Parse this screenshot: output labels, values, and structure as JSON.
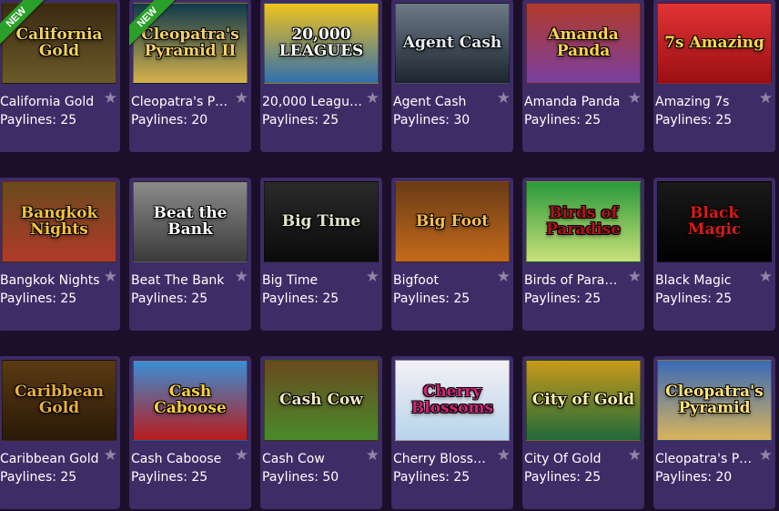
{
  "games": [
    {
      "title": "California Gold",
      "paylines": "Paylines: 25",
      "art": "California Gold",
      "badge": "NEW",
      "bg": "linear-gradient(#3b2a10,#6b5a2a)",
      "fg": "#f4d35a"
    },
    {
      "title": "Cleopatra's Pyr…",
      "paylines": "Paylines: 20",
      "art": "Cleopatra's Pyramid II",
      "badge": "NEW",
      "bg": "linear-gradient(#0f3a4c,#d6b24a)",
      "fg": "#f6d16a"
    },
    {
      "title": "20,000 Leagues",
      "paylines": "Paylines: 25",
      "art": "20,000 LEAGUES",
      "badge": "",
      "bg": "linear-gradient(#f0c21c,#2f6fb0)",
      "fg": "#ffffff"
    },
    {
      "title": "Agent Cash",
      "paylines": "Paylines: 30",
      "art": "Agent Cash",
      "badge": "",
      "bg": "linear-gradient(#6d7a86,#1c2530)",
      "fg": "#e8edf2"
    },
    {
      "title": "Amanda Panda",
      "paylines": "Paylines: 25",
      "art": "Amanda Panda",
      "badge": "",
      "bg": "linear-gradient(#b23a2a,#7a3fa0)",
      "fg": "#ffd54a"
    },
    {
      "title": "Amazing 7s",
      "paylines": "Paylines: 25",
      "art": "7s Amazing",
      "badge": "",
      "bg": "linear-gradient(#e23434,#9a0f12)",
      "fg": "#ffd84a"
    },
    {
      "title": "Bangkok Nights",
      "paylines": "Paylines: 25",
      "art": "Bangkok Nights",
      "badge": "",
      "bg": "linear-gradient(#6a4a1c,#b13a2a)",
      "fg": "#f3c23c"
    },
    {
      "title": "Beat The Bank",
      "paylines": "Paylines: 25",
      "art": "Beat the Bank",
      "badge": "",
      "bg": "linear-gradient(#8a8a8a,#3b3b3b)",
      "fg": "#ffffff"
    },
    {
      "title": "Big Time",
      "paylines": "Paylines: 25",
      "art": "Big Time",
      "badge": "",
      "bg": "linear-gradient(#2a2a2a,#0b0b0b)",
      "fg": "#dfe6c8"
    },
    {
      "title": "Bigfoot",
      "paylines": "Paylines: 25",
      "art": "Big Foot",
      "badge": "",
      "bg": "linear-gradient(#6a3c16,#c46a1a)",
      "fg": "#f7c04a"
    },
    {
      "title": "Birds of Paradise",
      "paylines": "Paylines: 25",
      "art": "Birds of Paradise",
      "badge": "",
      "bg": "linear-gradient(#2a9a3a,#c8e07a)",
      "fg": "#b3121c"
    },
    {
      "title": "Black Magic",
      "paylines": "Paylines: 25",
      "art": "Black Magic",
      "badge": "",
      "bg": "linear-gradient(#1a1a1a,#000000)",
      "fg": "#d81b1b"
    },
    {
      "title": "Caribbean Gold",
      "paylines": "Paylines: 25",
      "art": "Caribbean Gold",
      "badge": "",
      "bg": "linear-gradient(#5a3a12,#2a1a08)",
      "fg": "#e9b13a"
    },
    {
      "title": "Cash Caboose",
      "paylines": "Paylines: 25",
      "art": "Cash Caboose",
      "badge": "",
      "bg": "linear-gradient(#3a8fd6,#b81c1c)",
      "fg": "#ffd23a"
    },
    {
      "title": "Cash Cow",
      "paylines": "Paylines: 50",
      "art": "Cash Cow",
      "badge": "",
      "bg": "linear-gradient(#6a4a20,#4a8a2a)",
      "fg": "#f4e6c2"
    },
    {
      "title": "Cherry Blossoms",
      "paylines": "Paylines: 25",
      "art": "Cherry Blossoms",
      "badge": "",
      "bg": "linear-gradient(#f4f0f4,#b8d4ec)",
      "fg": "#d3247a"
    },
    {
      "title": "City Of Gold",
      "paylines": "Paylines: 25",
      "art": "City of Gold",
      "badge": "",
      "bg": "linear-gradient(#c89a1a,#1f6a3a)",
      "fg": "#fff2a8"
    },
    {
      "title": "Cleopatra's Pyr…",
      "paylines": "Paylines: 20",
      "art": "Cleopatra's Pyramid",
      "badge": "",
      "bg": "linear-gradient(#3a6ab8,#d8b45a)",
      "fg": "#ffe27a"
    }
  ],
  "favorite_icon": "star-icon"
}
